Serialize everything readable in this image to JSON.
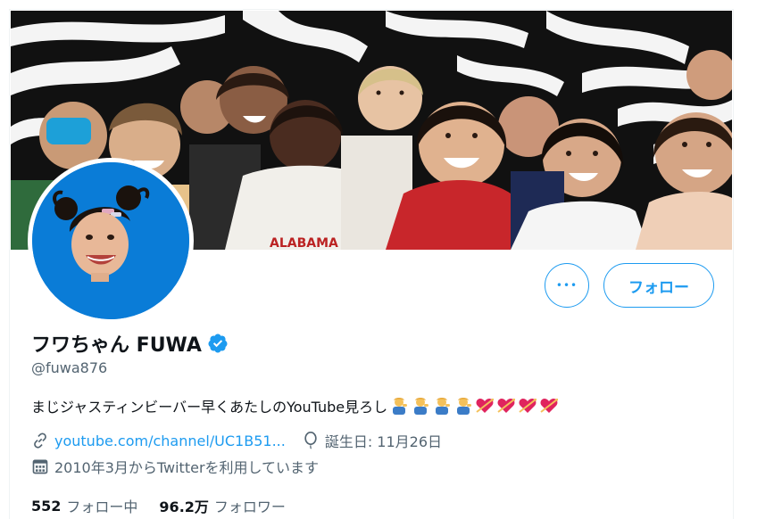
{
  "profile": {
    "display_name": "フワちゃん FUWA",
    "handle": "@fuwa876",
    "bio_text": "まじジャスティンビーバー早くあたしのYouTube見ろし",
    "bio_emojis": [
      "man-tipping-hand",
      "man-tipping-hand",
      "man-tipping-hand",
      "man-tipping-hand",
      "heart-with-arrow",
      "heart-with-arrow",
      "heart-with-arrow",
      "heart-with-arrow"
    ],
    "website": "youtube.com/channel/UC1B51...",
    "birthday": "誕生日: 11月26日",
    "joined": "2010年3月からTwitterを利用しています"
  },
  "buttons": {
    "more_label": "•••",
    "follow_label": "フォロー"
  },
  "stats": {
    "following_count": "552",
    "following_label": "フォロー中",
    "followers_count": "96.2万",
    "followers_label": "フォロワー"
  },
  "colors": {
    "accent": "#1d9bf0",
    "verified": "#1d9bf0",
    "avatar_bg": "#0a7cd7",
    "secondary_text": "#536471"
  }
}
